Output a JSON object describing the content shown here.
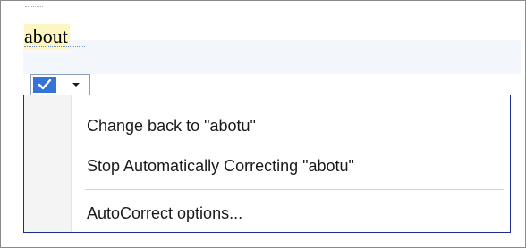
{
  "document": {
    "word": "about"
  },
  "smart_tag": {
    "check_icon": "checkmark-icon",
    "dropdown_icon": "dropdown-arrow-icon",
    "accent_color": "#3673d8"
  },
  "menu": {
    "items": [
      {
        "label": "Change back to \"abotu\""
      },
      {
        "label": "Stop Automatically Correcting \"abotu\""
      },
      {
        "label": "AutoCorrect options..."
      }
    ],
    "border_color": "#1e2a8c"
  }
}
